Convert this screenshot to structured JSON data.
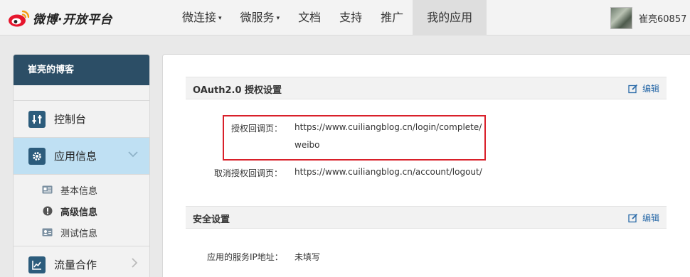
{
  "brand": {
    "name": "微博·开放平台"
  },
  "nav": {
    "items": [
      {
        "label": "微连接",
        "has_dropdown": true
      },
      {
        "label": "微服务",
        "has_dropdown": true
      },
      {
        "label": "文档",
        "has_dropdown": false
      },
      {
        "label": "支持",
        "has_dropdown": false
      },
      {
        "label": "推广",
        "has_dropdown": false
      },
      {
        "label": "我的应用",
        "has_dropdown": false,
        "active": true
      }
    ],
    "caret": "▾"
  },
  "user": {
    "name": "崔亮60857"
  },
  "sidebar": {
    "app_name": "崔亮的博客",
    "items": [
      {
        "label": "控制台",
        "icon": "sliders-icon"
      },
      {
        "label": "应用信息",
        "icon": "gear-icon",
        "active": true,
        "expanded": true
      },
      {
        "label": "流量合作",
        "icon": "chart-icon"
      }
    ],
    "subitems": [
      {
        "label": "基本信息",
        "icon": "id-card-icon"
      },
      {
        "label": "高级信息",
        "icon": "alert-circle-icon",
        "bold": true
      },
      {
        "label": "测试信息",
        "icon": "test-user-icon"
      }
    ]
  },
  "main": {
    "oauth": {
      "title": "OAuth2.0 授权设置",
      "edit_label": "编辑",
      "callback_label": "授权回调页：",
      "callback_value_line1": "https://www.cuiliangblog.cn/login/complete/",
      "callback_value_line2": "weibo",
      "cancel_label": "取消授权回调页：",
      "cancel_value": "https://www.cuiliangblog.cn/account/logout/"
    },
    "security": {
      "title": "安全设置",
      "edit_label": "编辑",
      "ip_label": "应用的服务IP地址：",
      "ip_value": "未填写"
    }
  },
  "colors": {
    "sidebar_header": "#2c4e66",
    "sidebar_active": "#bfe0f3",
    "link": "#2a6aa8",
    "highlight": "#d9202a"
  }
}
